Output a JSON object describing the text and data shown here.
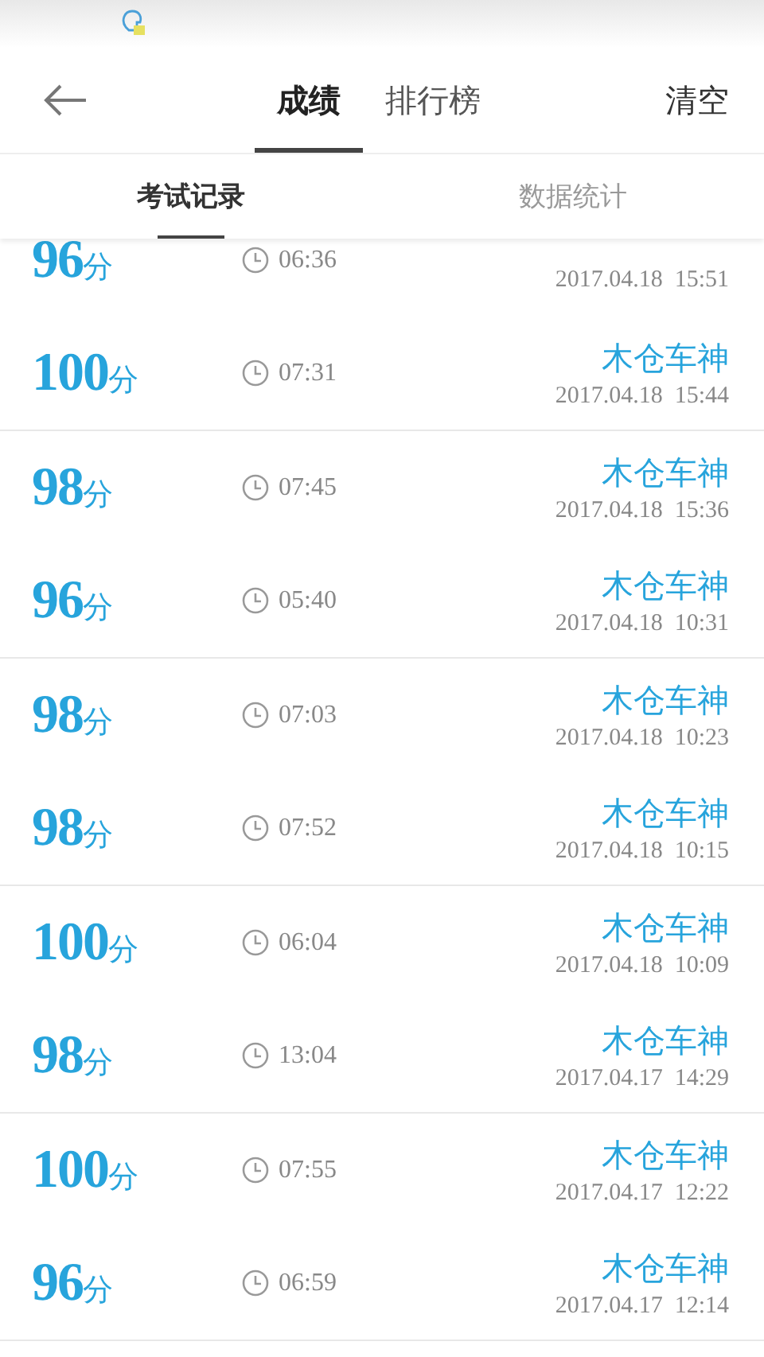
{
  "toolbar": {
    "tabs": [
      {
        "label": "成绩",
        "selected": true
      },
      {
        "label": "排行榜",
        "selected": false
      }
    ],
    "action": "清空"
  },
  "subtabs": [
    {
      "label": "考试记录",
      "selected": true
    },
    {
      "label": "数据统计",
      "selected": false
    }
  ],
  "records": [
    {
      "score": "96",
      "unit": "分",
      "duration": "06:36",
      "date": "2017.04.18  15:51"
    },
    {
      "score": "100",
      "unit": "分",
      "duration": "07:31",
      "name": "木仓车神",
      "date": "2017.04.18  15:44"
    },
    {
      "score": "98",
      "unit": "分",
      "duration": "07:45",
      "name": "木仓车神",
      "date": "2017.04.18  15:36"
    },
    {
      "score": "96",
      "unit": "分",
      "duration": "05:40",
      "name": "木仓车神",
      "date": "2017.04.18  10:31"
    },
    {
      "score": "98",
      "unit": "分",
      "duration": "07:03",
      "name": "木仓车神",
      "date": "2017.04.18  10:23"
    },
    {
      "score": "98",
      "unit": "分",
      "duration": "07:52",
      "name": "木仓车神",
      "date": "2017.04.18  10:15"
    },
    {
      "score": "100",
      "unit": "分",
      "duration": "06:04",
      "name": "木仓车神",
      "date": "2017.04.18  10:09"
    },
    {
      "score": "98",
      "unit": "分",
      "duration": "13:04",
      "name": "木仓车神",
      "date": "2017.04.17  14:29"
    },
    {
      "score": "100",
      "unit": "分",
      "duration": "07:55",
      "name": "木仓车神",
      "date": "2017.04.17  12:22"
    },
    {
      "score": "96",
      "unit": "分",
      "duration": "06:59",
      "name": "木仓车神",
      "date": "2017.04.17  12:14"
    }
  ]
}
